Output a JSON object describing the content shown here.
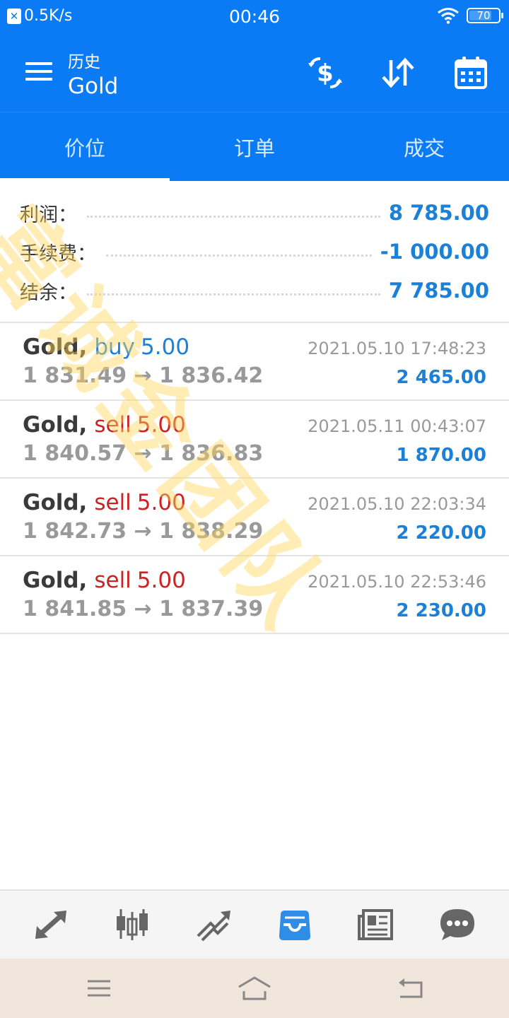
{
  "status_bar": {
    "net_speed": "0.5K/s",
    "time": "00:46",
    "battery": "70"
  },
  "app_bar": {
    "subtitle": "历史",
    "title": "Gold"
  },
  "tabs": [
    {
      "label": "价位"
    },
    {
      "label": "订单"
    },
    {
      "label": "成交"
    }
  ],
  "summary": {
    "profit_label": "利润：",
    "profit_value": "8 785.00",
    "fee_label": "手续费：",
    "fee_value": "-1 000.00",
    "balance_label": "结余：",
    "balance_value": "7 785.00"
  },
  "trades": [
    {
      "symbol": "Gold,",
      "side": "buy",
      "volume": "5.00",
      "time": "2021.05.10 17:48:23",
      "prices": "1 831.49 → 1 836.42",
      "profit": "2 465.00"
    },
    {
      "symbol": "Gold,",
      "side": "sell",
      "volume": "5.00",
      "time": "2021.05.11 00:43:07",
      "prices": "1 840.57 → 1 836.83",
      "profit": "1 870.00"
    },
    {
      "symbol": "Gold,",
      "side": "sell",
      "volume": "5.00",
      "time": "2021.05.10 22:03:34",
      "prices": "1 842.73 → 1 838.29",
      "profit": "2 220.00"
    },
    {
      "symbol": "Gold,",
      "side": "sell",
      "volume": "5.00",
      "time": "2021.05.10 22:53:46",
      "prices": "1 841.85 → 1 837.39",
      "profit": "2 230.00"
    }
  ],
  "watermark": "富诚金团队",
  "colors": {
    "primary": "#0a7bf5",
    "buy": "#1a80d8",
    "sell": "#cc2222",
    "profit": "#1a80d8"
  },
  "icons": {
    "app_bar": [
      "currency-exchange-icon",
      "sort-icon",
      "calendar-icon"
    ],
    "bottom_nav": [
      "quotes-icon",
      "chart-icon",
      "trade-icon",
      "history-icon",
      "news-icon",
      "chat-icon"
    ],
    "system": [
      "recent-apps-icon",
      "home-icon",
      "back-icon"
    ]
  }
}
